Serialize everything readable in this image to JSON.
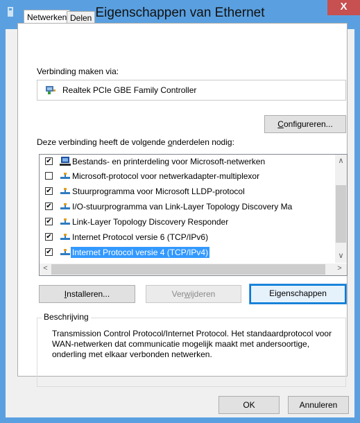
{
  "window": {
    "title": "Eigenschappen van Ethernet",
    "close_glyph": "X"
  },
  "tabs": [
    {
      "label": "Netwerken",
      "active": true
    },
    {
      "label": "Delen",
      "active": false
    }
  ],
  "connect_via": {
    "label": "Verbinding maken via:",
    "adapter_name": "Realtek PCIe GBE Family Controller",
    "configure_button_prefix": "C",
    "configure_button_rest": "onfigureren..."
  },
  "components": {
    "label_prefix": "Deze verbinding heeft de volgende ",
    "label_underlined": "o",
    "label_suffix": "nderdelen nodig:",
    "items": [
      {
        "label": "Bestands- en printerdeling voor Microsoft-netwerken",
        "checked": true,
        "icon": "network-client-icon",
        "selected": false
      },
      {
        "label": "Microsoft-protocol voor netwerkadapter-multiplexor",
        "checked": false,
        "icon": "protocol-icon",
        "selected": false
      },
      {
        "label": "Stuurprogramma voor Microsoft LLDP-protocol",
        "checked": true,
        "icon": "protocol-icon",
        "selected": false
      },
      {
        "label": "I/O-stuurprogramma van Link-Layer Topology Discovery Ma",
        "checked": true,
        "icon": "protocol-icon",
        "selected": false
      },
      {
        "label": "Link-Layer Topology Discovery Responder",
        "checked": true,
        "icon": "protocol-icon",
        "selected": false
      },
      {
        "label": "Internet Protocol versie 6 (TCP/IPv6)",
        "checked": true,
        "icon": "protocol-icon",
        "selected": false
      },
      {
        "label": "Internet Protocol versie 4 (TCP/IPv4)",
        "checked": true,
        "icon": "protocol-icon",
        "selected": true
      }
    ]
  },
  "buttons": {
    "install_u": "I",
    "install_rest": "nstalleren...",
    "remove_a": "Ver",
    "remove_u": "w",
    "remove_b": "ijderen",
    "properties_a": "Ei",
    "properties_u": "g",
    "properties_b": "enschappen",
    "ok": "OK",
    "cancel": "Annuleren"
  },
  "description": {
    "title": "Beschrijving",
    "text": "Transmission Control Protocol/Internet Protocol. Het standaardprotocol voor WAN-netwerken dat communicatie mogelijk maakt met andersoortige, onderling met elkaar verbonden netwerken."
  },
  "colors": {
    "title_bar": "#5aa0e0",
    "close_button": "#c75050",
    "selection": "#3399ff",
    "focus_ring": "#0078d7"
  }
}
